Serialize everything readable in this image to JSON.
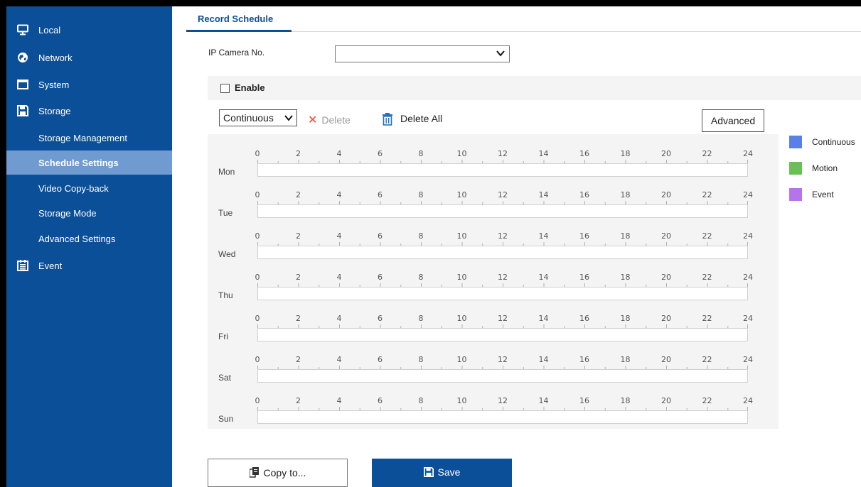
{
  "sidebar": {
    "items": [
      {
        "label": "Local",
        "icon": "monitor-icon"
      },
      {
        "label": "Network",
        "icon": "globe-icon"
      },
      {
        "label": "System",
        "icon": "window-icon"
      },
      {
        "label": "Storage",
        "icon": "floppy-icon"
      }
    ],
    "storage_children": [
      {
        "label": "Storage Management"
      },
      {
        "label": "Schedule Settings",
        "active": true
      },
      {
        "label": "Video Copy-back"
      },
      {
        "label": "Storage Mode"
      },
      {
        "label": "Advanced Settings"
      }
    ],
    "event": {
      "label": "Event",
      "icon": "calendar-icon"
    }
  },
  "tab": {
    "label": "Record Schedule"
  },
  "camera": {
    "label": "IP Camera No.",
    "value": ""
  },
  "enable": {
    "label": "Enable",
    "checked": false
  },
  "toolbar": {
    "type_value": "Continuous",
    "delete_label": "Delete",
    "delete_all_label": "Delete All",
    "advanced_label": "Advanced"
  },
  "schedule": {
    "days": [
      "Mon",
      "Tue",
      "Wed",
      "Thu",
      "Fri",
      "Sat",
      "Sun"
    ],
    "hour_labels": [
      "0",
      "2",
      "4",
      "6",
      "8",
      "10",
      "12",
      "14",
      "16",
      "18",
      "20",
      "22",
      "24"
    ]
  },
  "legend": [
    {
      "label": "Continuous",
      "color": "#5b7fe8"
    },
    {
      "label": "Motion",
      "color": "#6abf55"
    },
    {
      "label": "Event",
      "color": "#b574ea"
    }
  ],
  "actions": {
    "copy_label": "Copy to...",
    "save_label": "Save"
  },
  "colors": {
    "sidebar_bg": "#0b4f99",
    "active_item_bg": "#6f9bd1",
    "accent": "#0b4f99"
  }
}
